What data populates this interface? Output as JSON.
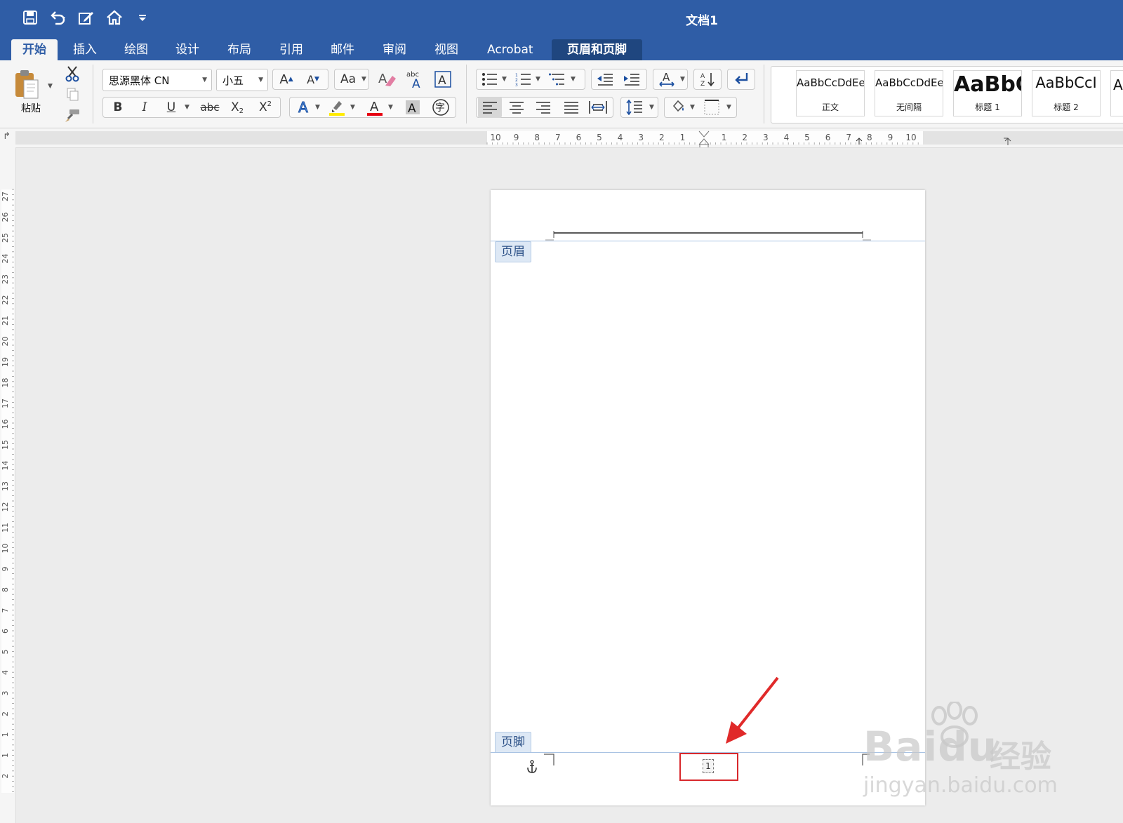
{
  "window": {
    "title": "文档1"
  },
  "tabs": [
    {
      "label": "开始"
    },
    {
      "label": "插入"
    },
    {
      "label": "绘图"
    },
    {
      "label": "设计"
    },
    {
      "label": "布局"
    },
    {
      "label": "引用"
    },
    {
      "label": "邮件"
    },
    {
      "label": "审阅"
    },
    {
      "label": "视图"
    },
    {
      "label": "Acrobat"
    },
    {
      "label": "页眉和页脚"
    }
  ],
  "ribbon": {
    "paste_label": "粘贴",
    "font_name": "思源黑体 CN",
    "font_size": "小五",
    "strike_label": "abc",
    "phonetic_label": "abc",
    "enclose_char": "字",
    "colors": {
      "highlight": "#ffeb00",
      "font_color": "#e60012"
    },
    "styles": [
      {
        "sample": "AaBbCcDdEe",
        "name": "正文"
      },
      {
        "sample": "AaBbCcDdEe",
        "name": "无间隔"
      },
      {
        "sample": "AaBbC",
        "name": "标题 1"
      },
      {
        "sample": "AaBbCcI",
        "name": "标题 2"
      },
      {
        "sample": "Aa",
        "name": ""
      }
    ]
  },
  "ruler": {
    "h_labels": [
      "10",
      "9",
      "8",
      "7",
      "6",
      "5",
      "4",
      "3",
      "2",
      "1",
      "1",
      "2",
      "3",
      "4",
      "5",
      "6",
      "7",
      "8",
      "9",
      "10"
    ],
    "v_labels": [
      "27",
      "26",
      "25",
      "24",
      "23",
      "22",
      "21",
      "20",
      "19",
      "18",
      "17",
      "16",
      "15",
      "14",
      "13",
      "12",
      "11",
      "10",
      "9",
      "8",
      "7",
      "6",
      "5",
      "4",
      "3",
      "2",
      "1",
      "1",
      "2"
    ]
  },
  "document": {
    "header_label": "页眉",
    "footer_label": "页脚",
    "page_number": "1"
  },
  "watermark": {
    "brand": "Baidu",
    "brand_cn": "经验",
    "url": "jingyan.baidu.com"
  }
}
